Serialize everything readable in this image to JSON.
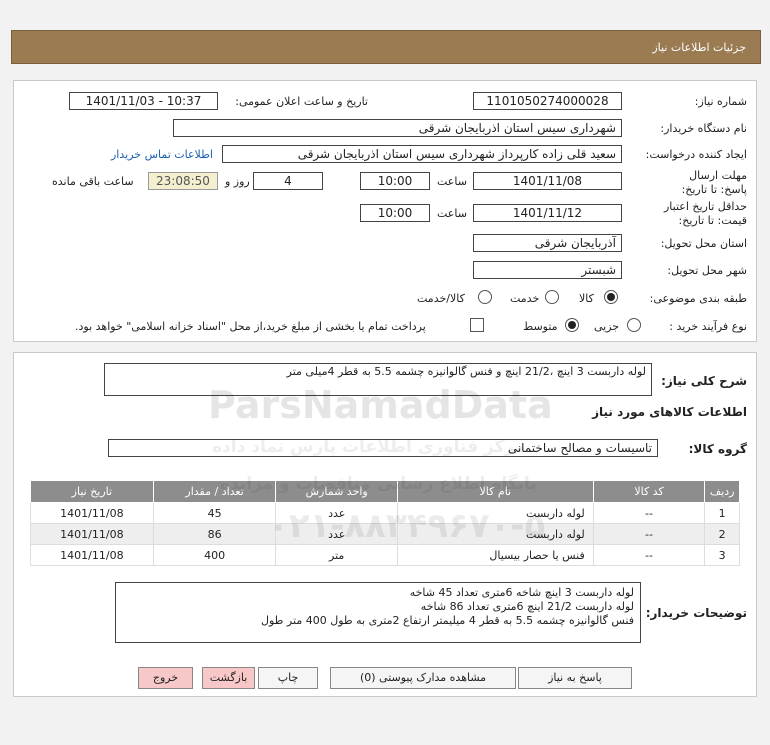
{
  "header": {
    "title": "جزئیات اطلاعات نیاز"
  },
  "need_number": {
    "label": "شماره نیاز:",
    "value": "1101050274000028"
  },
  "announce": {
    "label": "تاریخ و ساعت اعلان عمومی:",
    "value": "1401/11/03 - 10:37"
  },
  "buyer_org": {
    "label": "نام دستگاه خریدار:",
    "value": "شهرداری سیس استان اذربایجان شرقی"
  },
  "requester": {
    "label": "ایجاد کننده درخواست:",
    "value": "سعید قلی زاده کارپرداز شهرداری سیس استان اذربایجان شرقی",
    "contact_link": "اطلاعات تماس خریدار"
  },
  "deadline": {
    "label": "مهلت ارسال پاسخ: تا تاریخ:",
    "date": "1401/11/08",
    "time_label": "ساعت",
    "time": "10:00",
    "days": "4",
    "days_label": "روز و",
    "remaining": "23:08:50",
    "remaining_label": "ساعت باقی مانده"
  },
  "validity": {
    "label": "حداقل تاریخ اعتبار قیمت: تا تاریخ:",
    "date": "1401/11/12",
    "time_label": "ساعت",
    "time": "10:00"
  },
  "province": {
    "label": "استان محل تحویل:",
    "value": "آذربایجان شرقی"
  },
  "city": {
    "label": "شهر محل تحویل:",
    "value": "شبستر"
  },
  "category": {
    "label": "طبقه بندی موضوعی:",
    "options": [
      "کالا",
      "خدمت",
      "کالا/خدمت"
    ]
  },
  "purchase": {
    "label": "نوع فرآیند خرید :",
    "options": [
      "جزیی",
      "متوسط"
    ],
    "note": "پرداخت تمام یا بخشی از مبلغ خرید،از محل \"اسناد خزانه اسلامی\" خواهد بود."
  },
  "summary": {
    "label": "شرح کلی نیاز:",
    "value": "لوله داربست 3 اینچ ،21/2 اینچ  و فنس گالوانیزه چشمه 5.5 به قطر 4میلی متر"
  },
  "goods_info": {
    "title": "اطلاعات کالاهای مورد نیاز"
  },
  "goods_group": {
    "label": "گروه کالا:",
    "value": "تاسیسات و مصالح ساختمانی"
  },
  "table": {
    "headers": [
      "ردیف",
      "کد کالا",
      "نام کالا",
      "واحد شمارش",
      "تعداد / مقدار",
      "تاریخ نیاز"
    ],
    "rows": [
      [
        "1",
        "--",
        "لوله داربست",
        "عدد",
        "45",
        "1401/11/08"
      ],
      [
        "2",
        "--",
        "لوله داربست",
        "عدد",
        "86",
        "1401/11/08"
      ],
      [
        "3",
        "--",
        "فنس یا حصار بیسیال",
        "متر",
        "400",
        "1401/11/08"
      ]
    ]
  },
  "buyer_notes": {
    "label": "توضیحات خریدار:",
    "lines": [
      "لوله داربست 3 اینچ شاخه 6متری تعداد 45 شاخه",
      "لوله داربست 21/2 اینچ 6متری تعداد 86 شاخه",
      "فنس گالوانیزه چشمه 5.5 به قطر 4 میلیمتر ارتفاع 2متری به طول 400 متر طول"
    ]
  },
  "buttons": {
    "reply": "پاسخ به نیاز",
    "attachments": "مشاهده مدارک پیوستی (0)",
    "print": "چاپ",
    "back": "بازگشت",
    "exit": "خروج"
  },
  "watermark": {
    "brand": "ParsNamadData",
    "phone": "۰۲۱-۸۸۳۴۹۶۷۰-۵",
    "slogan": "پایگاه اطلاع رسانی مناقصات و مزایده",
    "tagline": "مرکز فناوری اطلاعات پارس نماد داده"
  }
}
